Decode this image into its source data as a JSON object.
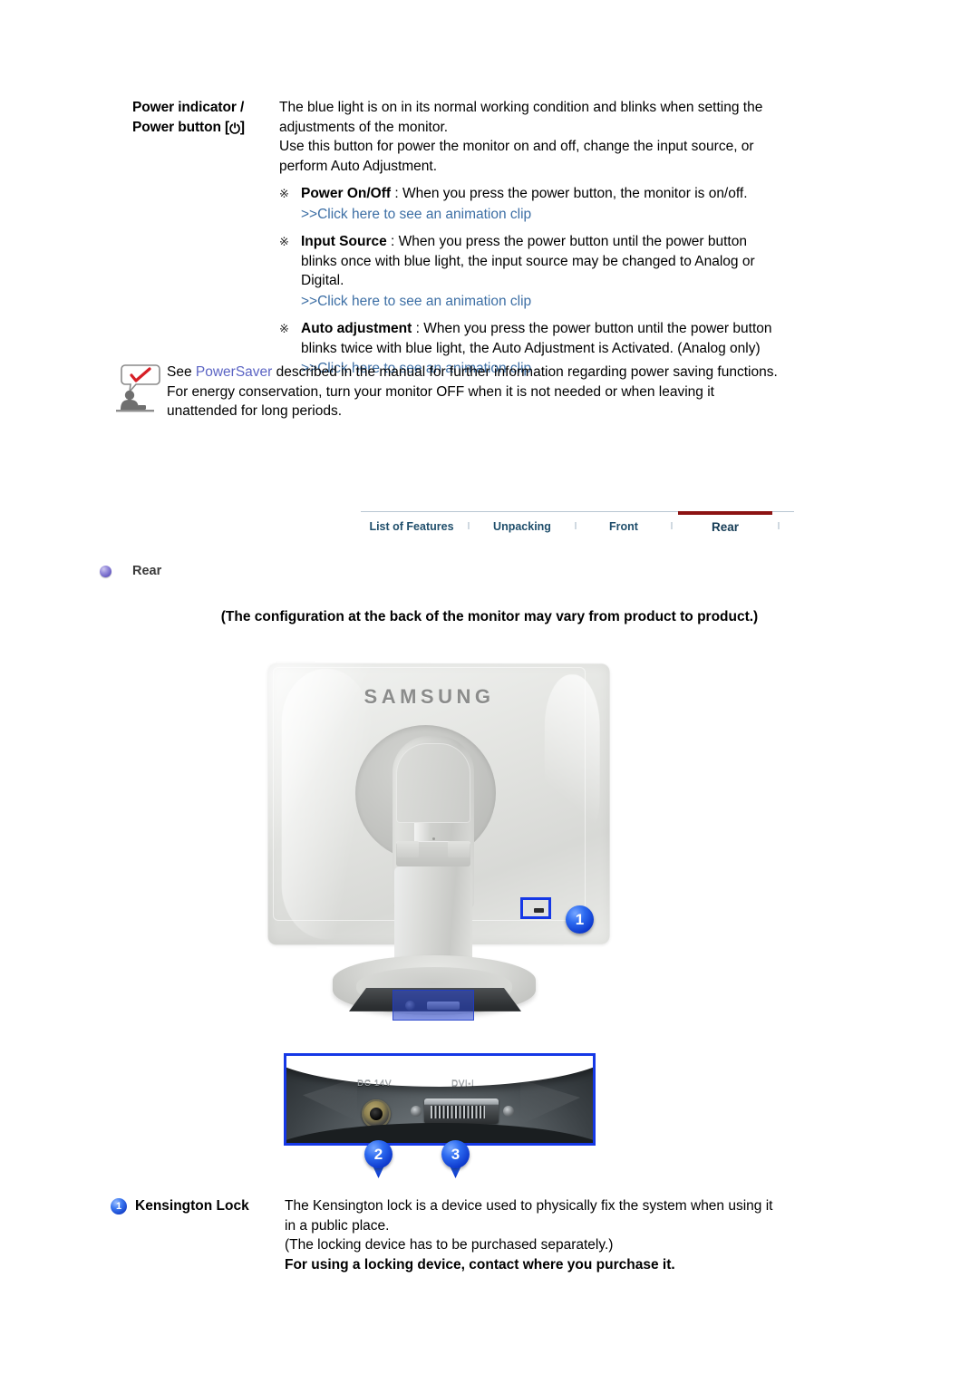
{
  "spec": {
    "label_line1": "Power indicator /",
    "label_line2_pre": "Power button [",
    "label_power_glyph": "⏻",
    "label_line2_post": "]",
    "intro": [
      "The blue light is on in its normal working condition and blinks when setting the adjustments of the monitor.",
      "Use this button for power the monitor on and off, change the input source, or perform Auto Adjustment."
    ],
    "items": [
      {
        "mark": "※",
        "term": "Power On/Off",
        "text": " : When you press the power button, the monitor is on/off.",
        "link": ">>Click here to see an animation clip"
      },
      {
        "mark": "※",
        "term": "Input Source",
        "text": " : When you press the power button until the power button blinks once with blue light, the input source may be changed to Analog or Digital.",
        "link": ">>Click here to see an animation clip"
      },
      {
        "mark": "※",
        "term": "Auto adjustment",
        "text": " : When you press the power button until the power button blinks twice with blue light, the Auto Adjustment is Activated. (Analog only)",
        "link": ">>Click here to see an animation clip"
      }
    ]
  },
  "note": {
    "icon": "note-person-checkmark-icon",
    "text_pre": "See ",
    "link": "PowerSaver",
    "text_post": " described in the manual for further information regarding power saving functions. For energy conservation, turn your monitor OFF when it is not needed or when leaving it unattended for long periods."
  },
  "tabs": {
    "separator": "l",
    "items": [
      {
        "label": "List of Features",
        "active": false
      },
      {
        "label": "Unpacking",
        "active": false
      },
      {
        "label": "Front",
        "active": false
      },
      {
        "label": "Rear",
        "active": true
      }
    ],
    "active_underline_color": "#8c1313",
    "link_color": "#1f4e6b"
  },
  "section": {
    "bullet": "purple-sphere-bullet",
    "heading": "Rear",
    "config_note": "(The configuration at the back of the monitor may vary from product to product.)"
  },
  "photo": {
    "brand": "SAMSUNG",
    "kensington_highlight": "kensington-lock-slot",
    "callouts": [
      {
        "id": "1",
        "target": "kensington-lock"
      },
      {
        "id": "2",
        "target": "dc-power-jack"
      },
      {
        "id": "3",
        "target": "dvi-i-port"
      }
    ]
  },
  "panel": {
    "ports": [
      {
        "label": "DC 14V",
        "name": "dc-power-jack"
      },
      {
        "label": "DVI-I",
        "name": "dvi-i-port"
      }
    ],
    "highlight_color": "#1538e6"
  },
  "kensington": {
    "badge": "1",
    "title": "Kensington Lock",
    "lines": [
      "The Kensington lock is a device used to physically fix the system when using it in a public place.",
      "(The locking device has to be purchased separately.)"
    ],
    "bold_line": "For using a locking device, contact where you purchase it."
  }
}
